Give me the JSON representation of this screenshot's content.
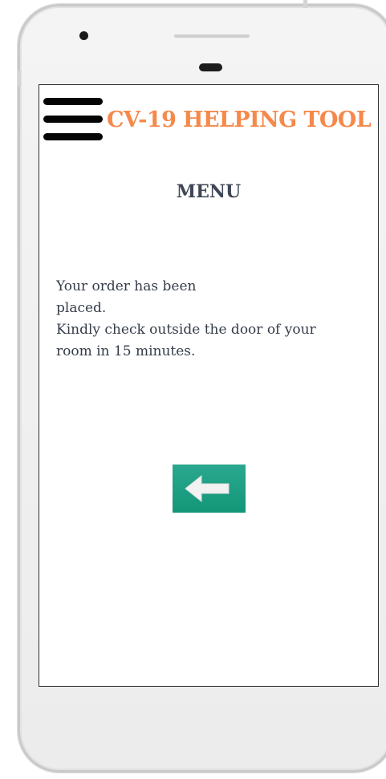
{
  "app": {
    "title": "CV-19 HELPING TOOL"
  },
  "header": {
    "menu_icon": "hamburger-menu-icon"
  },
  "page": {
    "heading": "MENU",
    "message_lines": [
      "Your order has been",
      "placed.",
      "Kindly check outside the door of your",
      "room in 15 minutes."
    ]
  },
  "back_button": {
    "icon": "left-arrow-icon",
    "color": "#1a9b80",
    "arrow_color": "#f2f2f2"
  },
  "colors": {
    "title": "#f5894c",
    "heading": "#3f4757",
    "body_text": "#343c4a"
  }
}
